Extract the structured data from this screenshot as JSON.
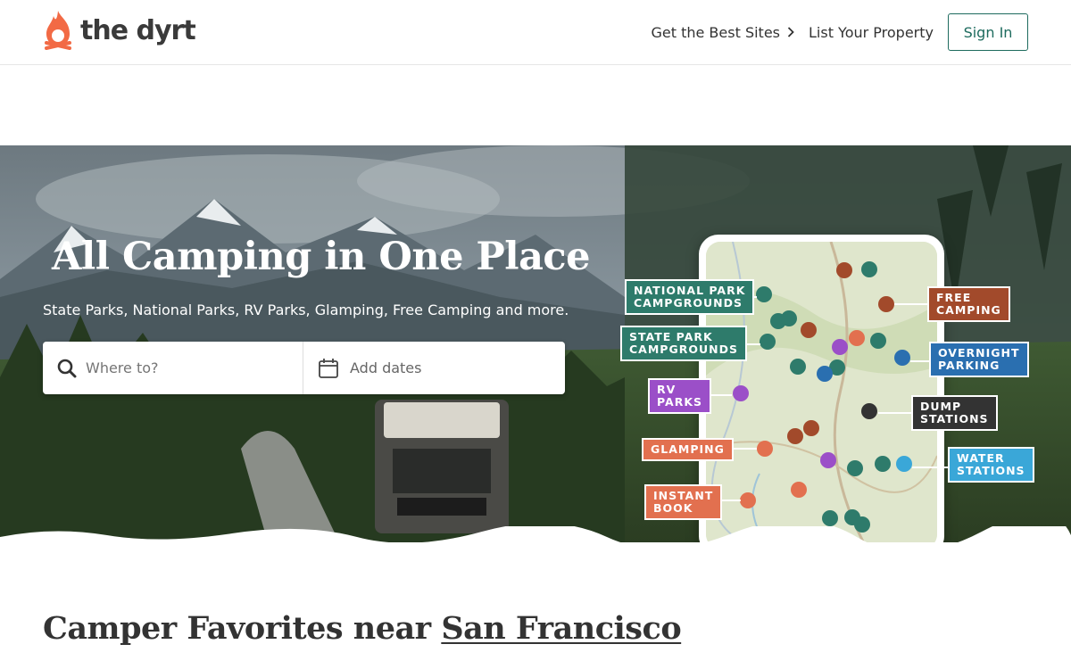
{
  "header": {
    "logo_text": "the dyrt",
    "nav": [
      {
        "label": "Get the Best Sites",
        "has_chevron": true
      },
      {
        "label": "List Your Property",
        "has_chevron": false
      }
    ],
    "sign_in_label": "Sign In"
  },
  "hero": {
    "title": "All Camping in One Place",
    "subtitle": "State Parks, National Parks, RV Parks, Glamping, Free Camping and more.",
    "search": {
      "where_placeholder": "Where to?",
      "dates_label": "Add dates"
    },
    "map_tags": {
      "national_park": [
        "NATIONAL PARK",
        "CAMPGROUNDS"
      ],
      "state_park": [
        "STATE PARK",
        "CAMPGROUNDS"
      ],
      "rv_parks": [
        "RV",
        "PARKS"
      ],
      "glamping": [
        "GLAMPING"
      ],
      "instant_book": [
        "INSTANT",
        "BOOK"
      ],
      "free_camping": [
        "FREE",
        "CAMPING"
      ],
      "overnight_parking": [
        "OVERNIGHT",
        "PARKING"
      ],
      "dump_stations": [
        "DUMP",
        "STATIONS"
      ],
      "water_stations": [
        "WATER",
        "STATIONS"
      ]
    },
    "tag_colors": {
      "national_park": "#2e7b6b",
      "state_park": "#2e7b6b",
      "rv_parks": "#9b4fc8",
      "glamping": "#e2704f",
      "instant_book": "#e2704f",
      "free_camping": "#a24a2b",
      "overnight_parking": "#2a6fb0",
      "dump_stations": "#333333",
      "water_stations": "#3aa7d8"
    }
  },
  "favorites": {
    "prefix": "Camper Favorites near ",
    "location": "San Francisco"
  },
  "colors": {
    "brand_orange": "#f26a45",
    "brand_green": "#1d6b5e"
  },
  "icons": {
    "logo": "campfire-flame-icon",
    "chevron": "chevron-right-icon",
    "search": "search-icon",
    "calendar": "calendar-icon"
  }
}
